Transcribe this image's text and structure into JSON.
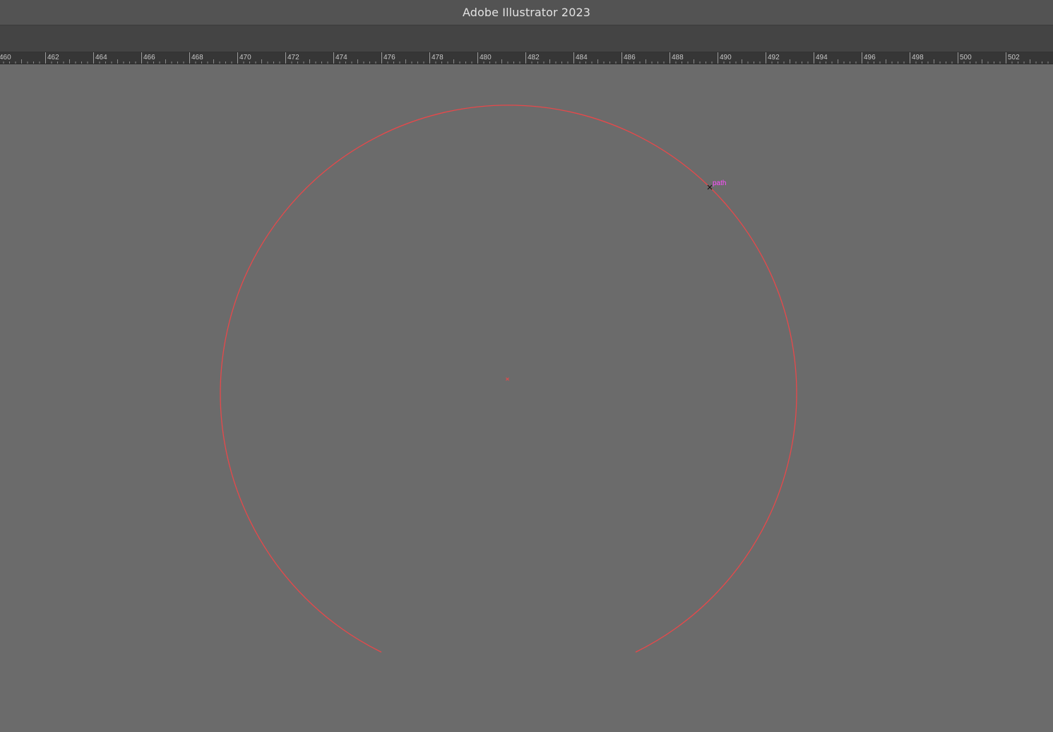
{
  "window": {
    "title": "Adobe Illustrator 2023"
  },
  "ruler": {
    "labels": [
      "460",
      "462",
      "464",
      "466",
      "468",
      "470",
      "472",
      "474",
      "476",
      "478",
      "480",
      "482",
      "484",
      "486",
      "488",
      "490",
      "492",
      "494",
      "496",
      "498",
      "500",
      "502"
    ]
  },
  "canvas": {
    "smart_guide_label": "path",
    "stroke_color": "#e8484a",
    "hint_color": "#ff4dff"
  }
}
